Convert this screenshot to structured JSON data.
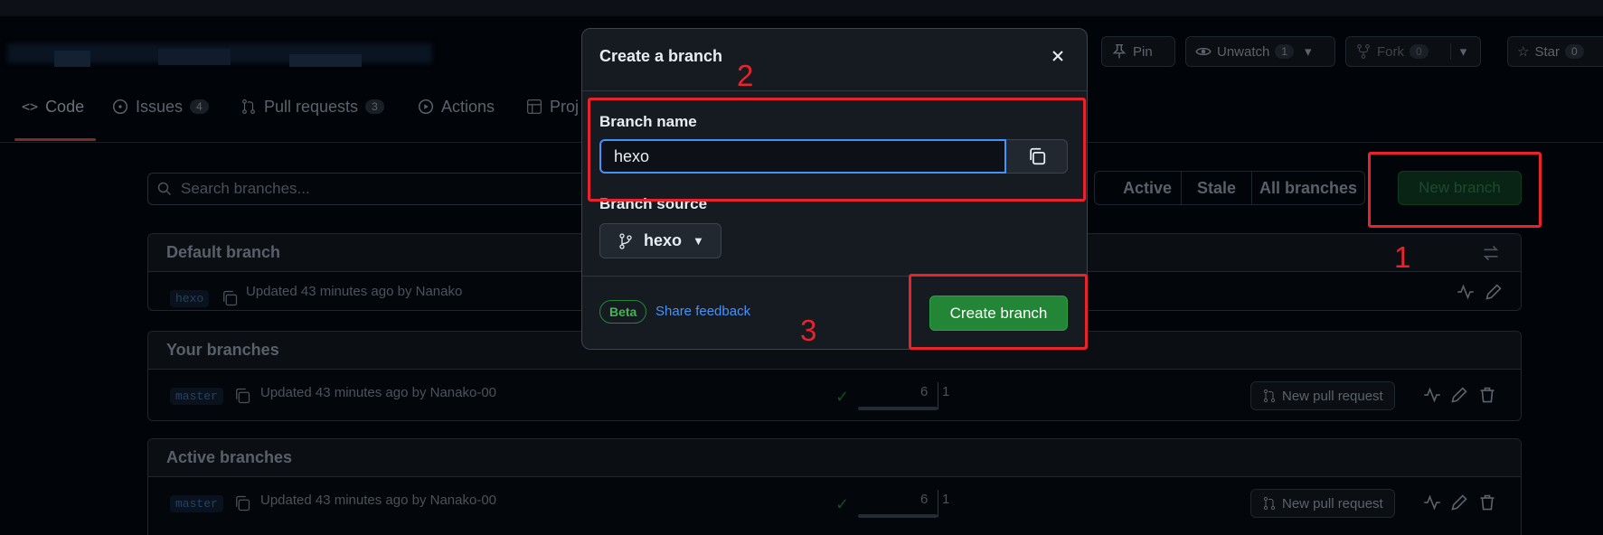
{
  "repo": {
    "pin_label": "Pin",
    "unwatch_label": "Unwatch",
    "unwatch_count": "1",
    "fork_label": "Fork",
    "fork_count": "0",
    "star_label": "Star",
    "star_count": "0"
  },
  "tabs": [
    {
      "label": "Code"
    },
    {
      "label": "Issues",
      "count": "4"
    },
    {
      "label": "Pull requests",
      "count": "3"
    },
    {
      "label": "Actions"
    },
    {
      "label": "Proj"
    }
  ],
  "branches_page": {
    "search_placeholder": "Search branches...",
    "filters": [
      "Active",
      "Stale",
      "All branches"
    ],
    "new_branch_label": "New branch",
    "sections": [
      {
        "title": "Default branch",
        "rows": [
          {
            "name": "hexo",
            "updated": "Updated 43 minutes ago by Nanako"
          }
        ]
      },
      {
        "title": "Your branches",
        "rows": [
          {
            "name": "master",
            "updated": "Updated 43 minutes ago by Nanako-00",
            "behind": "6",
            "ahead": "1",
            "pr_label": "New pull request"
          }
        ]
      },
      {
        "title": "Active branches",
        "rows": [
          {
            "name": "master",
            "updated": "Updated 43 minutes ago by Nanako-00",
            "behind": "6",
            "ahead": "1",
            "pr_label": "New pull request"
          }
        ]
      }
    ]
  },
  "modal": {
    "title": "Create a branch",
    "branch_name_label": "Branch name",
    "branch_name_value": "hexo",
    "branch_source_label": "Branch source",
    "branch_source_value": "hexo",
    "beta_label": "Beta",
    "feedback_label": "Share feedback",
    "create_label": "Create branch"
  },
  "annotations": [
    "1",
    "2",
    "3"
  ],
  "colors": {
    "annotation_red": "#e8232b",
    "primary_green": "#238636",
    "focus_blue": "#4493f8"
  }
}
